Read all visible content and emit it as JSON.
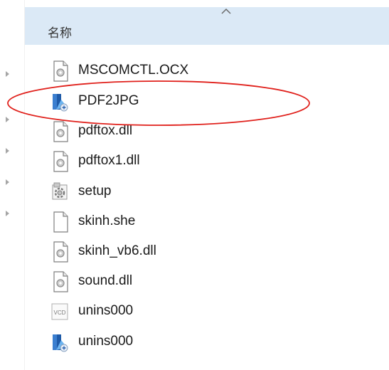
{
  "header": {
    "name_column": "名称"
  },
  "files": [
    {
      "name": "MSCOMCTL.OCX",
      "icon": "dll-gear-icon"
    },
    {
      "name": "PDF2JPG",
      "icon": "app-installer-icon"
    },
    {
      "name": "pdftox.dll",
      "icon": "dll-gear-icon"
    },
    {
      "name": "pdftox1.dll",
      "icon": "dll-gear-icon"
    },
    {
      "name": "setup",
      "icon": "setup-gear-icon"
    },
    {
      "name": "skinh.she",
      "icon": "blank-file-icon"
    },
    {
      "name": "skinh_vb6.dll",
      "icon": "dll-gear-icon"
    },
    {
      "name": "sound.dll",
      "icon": "dll-gear-icon"
    },
    {
      "name": "unins000",
      "icon": "vcd-file-icon"
    },
    {
      "name": "unins000",
      "icon": "app-installer-icon"
    }
  ],
  "highlight": {
    "color": "#e0201b",
    "target": "PDF2JPG"
  }
}
